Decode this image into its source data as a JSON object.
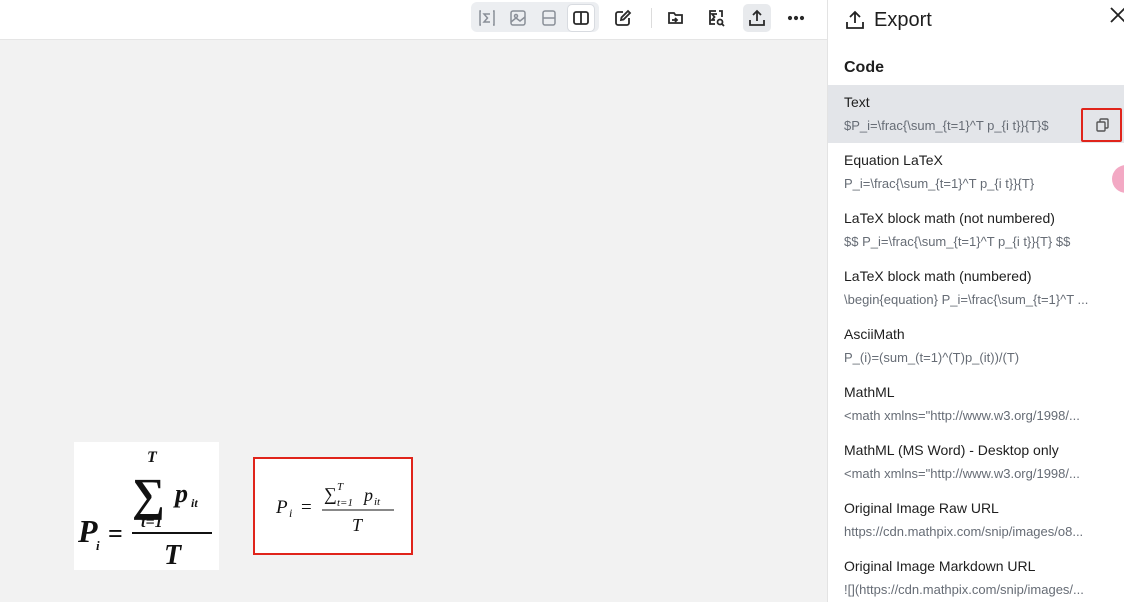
{
  "toolbar": {
    "tools": [
      {
        "icon": "sum-box-icon"
      },
      {
        "icon": "image-icon"
      },
      {
        "icon": "split-horizontal-icon"
      },
      {
        "icon": "split-vertical-icon"
      },
      {
        "icon": "edit-icon"
      },
      {
        "icon": "open-folder-icon"
      },
      {
        "icon": "formula-search-icon"
      },
      {
        "icon": "export-upload-icon"
      },
      {
        "icon": "more-icon"
      }
    ]
  },
  "canvas": {
    "rendered_equation": "P_i = (∑_{t=1}^T p_{it}) / T"
  },
  "export_panel": {
    "title": "Export",
    "section_title": "Code",
    "items": [
      {
        "label": "Text",
        "value": "$P_i=\\frac{\\sum_{t=1}^T p_{i t}}{T}$",
        "selected": true
      },
      {
        "label": "Equation LaTeX",
        "value": "P_i=\\frac{\\sum_{t=1}^T p_{i t}}{T}"
      },
      {
        "label": "LaTeX block math (not numbered)",
        "value": "$$ P_i=\\frac{\\sum_{t=1}^T p_{i t}}{T} $$"
      },
      {
        "label": "LaTeX block math (numbered)",
        "value": "\\begin{equation} P_i=\\frac{\\sum_{t=1}^T ..."
      },
      {
        "label": "AsciiMath",
        "value": "P_(i)=(sum_(t=1)^(T)p_(it))/(T)"
      },
      {
        "label": "MathML",
        "value": "<math xmlns=\"http://www.w3.org/1998/..."
      },
      {
        "label": "MathML (MS Word) - Desktop only",
        "value": "<math xmlns=\"http://www.w3.org/1998/..."
      },
      {
        "label": "Original Image Raw URL",
        "value": "https://cdn.mathpix.com/snip/images/o8..."
      },
      {
        "label": "Original Image Markdown URL",
        "value": "![](https://cdn.mathpix.com/snip/images/..."
      }
    ]
  },
  "colors": {
    "highlight_red": "#e0241b",
    "selected_row": "#e3e5e9",
    "accent_pink": "#f3a9c4"
  }
}
